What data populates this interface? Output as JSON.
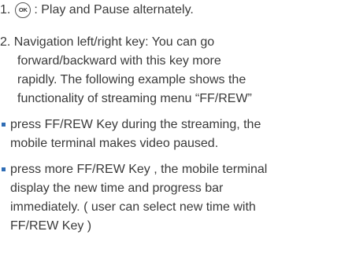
{
  "item1": {
    "number": "1.",
    "icon_label": "OK",
    "text": ": Play and Pause alternately."
  },
  "item2": {
    "lines": [
      "2. Navigation left/right key: You can go",
      "forward/backward  with this key more",
      "rapidly. The following example shows the",
      "functionality of streaming menu “FF/REW”"
    ]
  },
  "bullet1": {
    "lines": [
      "press FF/REW Key during the streaming, the",
      "mobile terminal makes video paused."
    ]
  },
  "bullet2": {
    "lines": [
      "press more FF/REW Key , the mobile terminal",
      "display the new time and progress bar",
      "immediately. ( user can select new time with",
      "FF/REW Key )"
    ]
  },
  "colors": {
    "text": "#3a3a3a",
    "bullet": "#2f6db5"
  }
}
